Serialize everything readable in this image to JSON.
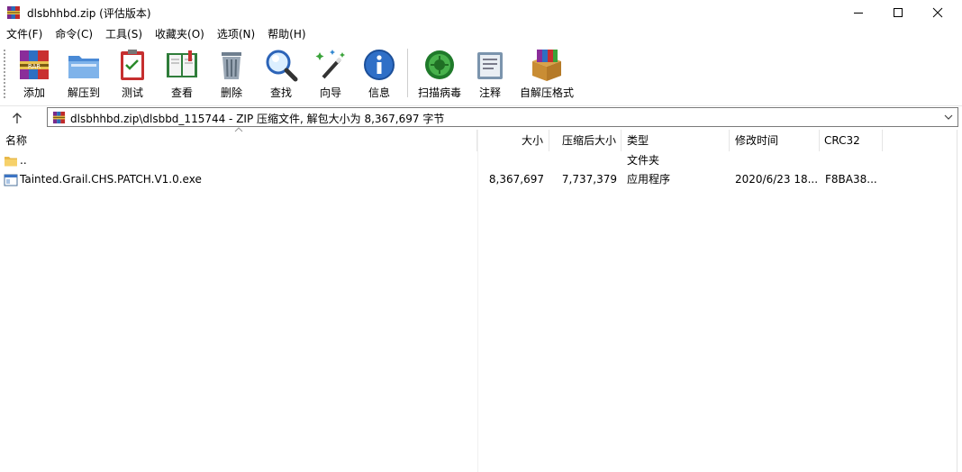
{
  "window": {
    "title": "dlsbhhbd.zip (评估版本)",
    "icon": "winrar-icon",
    "controls": [
      "minimize-icon",
      "maximize-icon",
      "close-icon"
    ]
  },
  "menu": [
    "文件(F)",
    "命令(C)",
    "工具(S)",
    "收藏夹(O)",
    "选项(N)",
    "帮助(H)"
  ],
  "toolbar": {
    "buttons": [
      {
        "label": "添加",
        "icon": "add-archive-icon"
      },
      {
        "label": "解压到",
        "icon": "extract-folder-icon"
      },
      {
        "label": "测试",
        "icon": "test-clipboard-icon"
      },
      {
        "label": "查看",
        "icon": "view-book-icon"
      },
      {
        "label": "删除",
        "icon": "trash-icon"
      },
      {
        "label": "查找",
        "icon": "magnifier-icon"
      },
      {
        "label": "向导",
        "icon": "wizard-wand-icon"
      },
      {
        "label": "信息",
        "icon": "info-icon"
      },
      {
        "label": "扫描病毒",
        "icon": "virus-scan-icon"
      },
      {
        "label": "注释",
        "icon": "comment-icon"
      },
      {
        "label": "自解压格式",
        "icon": "sfx-box-icon"
      }
    ]
  },
  "address": {
    "path": "dlsbhhbd.zip\\dlsbbd_115744 - ZIP 压缩文件, 解包大小为 8,367,697 字节"
  },
  "columns": [
    "名称",
    "大小",
    "压缩后大小",
    "类型",
    "修改时间",
    "CRC32"
  ],
  "rows": [
    {
      "name": "..",
      "size": "",
      "packed": "",
      "type": "文件夹",
      "modified": "",
      "crc": "",
      "icon": "folder-icon"
    },
    {
      "name": "Tainted.Grail.CHS.PATCH.V1.0.exe",
      "size": "8,367,697",
      "packed": "7,737,379",
      "type": "应用程序",
      "modified": "2020/6/23 18...",
      "crc": "F8BA38...",
      "icon": "exe-file-icon"
    }
  ]
}
